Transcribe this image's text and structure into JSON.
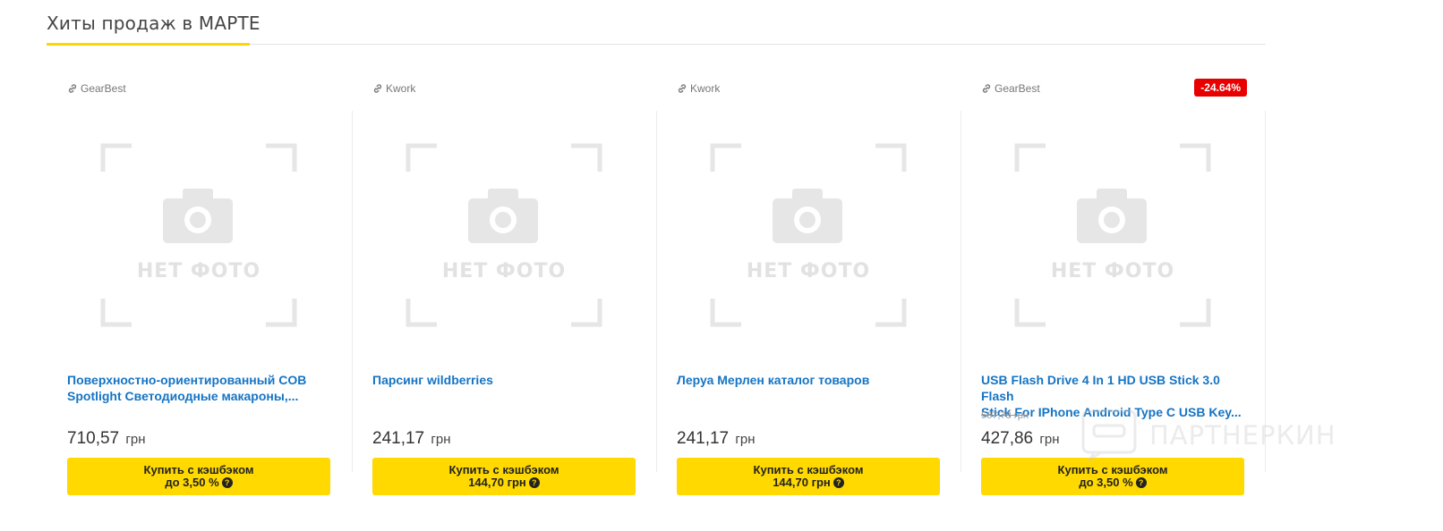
{
  "section": {
    "title": "Хиты продаж в МАРТЕ"
  },
  "colors": {
    "accent": "#ffd600",
    "button": "#ffd900",
    "link": "#1574c4",
    "discount": "#e80000"
  },
  "placeholder": {
    "text": "НЕТ ФОТО",
    "icon": "camera-icon"
  },
  "products": [
    {
      "store": "GearBest",
      "title_line1": "Поверхностно-ориентированный COB",
      "title_line2": "Spotlight Светодиодные макароны,...",
      "old_price": "",
      "price": "710,57",
      "currency": "грн",
      "btn_line1": "Купить с кэшбэком",
      "btn_line2": "до 3,50 %"
    },
    {
      "store": "Kwork",
      "title_line1": "Парсинг wildberries",
      "title_line2": "",
      "old_price": "",
      "price": "241,17",
      "currency": "грн",
      "btn_line1": "Купить с кэшбэком",
      "btn_line2": "144,70 грн"
    },
    {
      "store": "Kwork",
      "title_line1": "Леруа Мерлен каталог товаров",
      "title_line2": "",
      "old_price": "",
      "price": "241,17",
      "currency": "грн",
      "btn_line1": "Купить с кэшбэком",
      "btn_line2": "144,70 грн"
    },
    {
      "store": "GearBest",
      "discount": "-24.64%",
      "title_line1": "USB Flash Drive 4 In 1 HD USB Stick 3.0 Flash",
      "title_line2": "Stick For IPhone Android Type C USB Key...",
      "old_price": "567,78 грн",
      "price": "427,86",
      "currency": "грн",
      "btn_line1": "Купить с кэшбэком",
      "btn_line2": "до 3,50 %"
    }
  ],
  "watermark": {
    "text": "ПАРТНЕРКИН"
  }
}
